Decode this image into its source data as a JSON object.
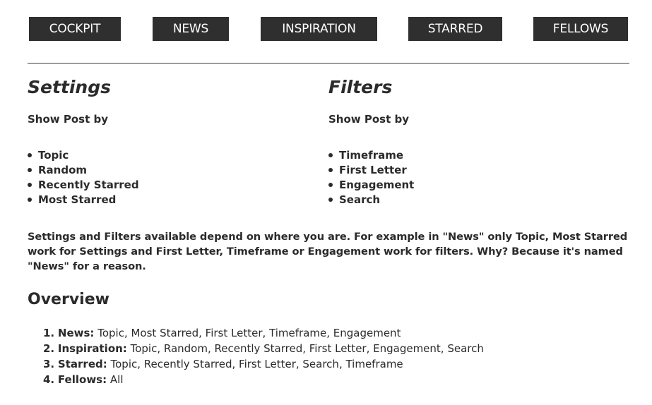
{
  "nav": {
    "buttons": [
      {
        "label": "COCKPIT"
      },
      {
        "label": "NEWS"
      },
      {
        "label": "INSPIRATION"
      },
      {
        "label": "STARRED"
      },
      {
        "label": "FELLOWS"
      }
    ]
  },
  "settings": {
    "heading": "Settings",
    "subheading": "Show Post by",
    "items": [
      "Topic",
      "Random",
      "Recently Starred",
      "Most Starred"
    ]
  },
  "filters": {
    "heading": "Filters",
    "subheading": "Show Post by",
    "items": [
      "Timeframe",
      "First Letter",
      "Engagement",
      "Search"
    ]
  },
  "info_text": "Settings and Filters available depend on where you are. For example in \"News\" only Topic, Most Starred work for Settings and First Letter, Timeframe or Engagement work for filters. Why? Because it's named \"News\" for a reason.",
  "overview": {
    "title": "Overview",
    "items": [
      {
        "num": "1.",
        "label": "News:",
        "value": "Topic, Most Starred, First Letter, Timeframe, Engagement"
      },
      {
        "num": "2.",
        "label": "Inspiration:",
        "value": "Topic, Random, Recently Starred, First Letter, Engagement, Search"
      },
      {
        "num": "3.",
        "label": "Starred:",
        "value": "Topic, Recently Starred, First Letter, Search, Timeframe"
      },
      {
        "num": "4.",
        "label": "Fellows:",
        "value": "All"
      }
    ]
  },
  "colors": {
    "nav_background": "#2f2f2f",
    "nav_text": "#ffffff",
    "text": "#2b2b2b",
    "page_background": "#ffffff"
  }
}
